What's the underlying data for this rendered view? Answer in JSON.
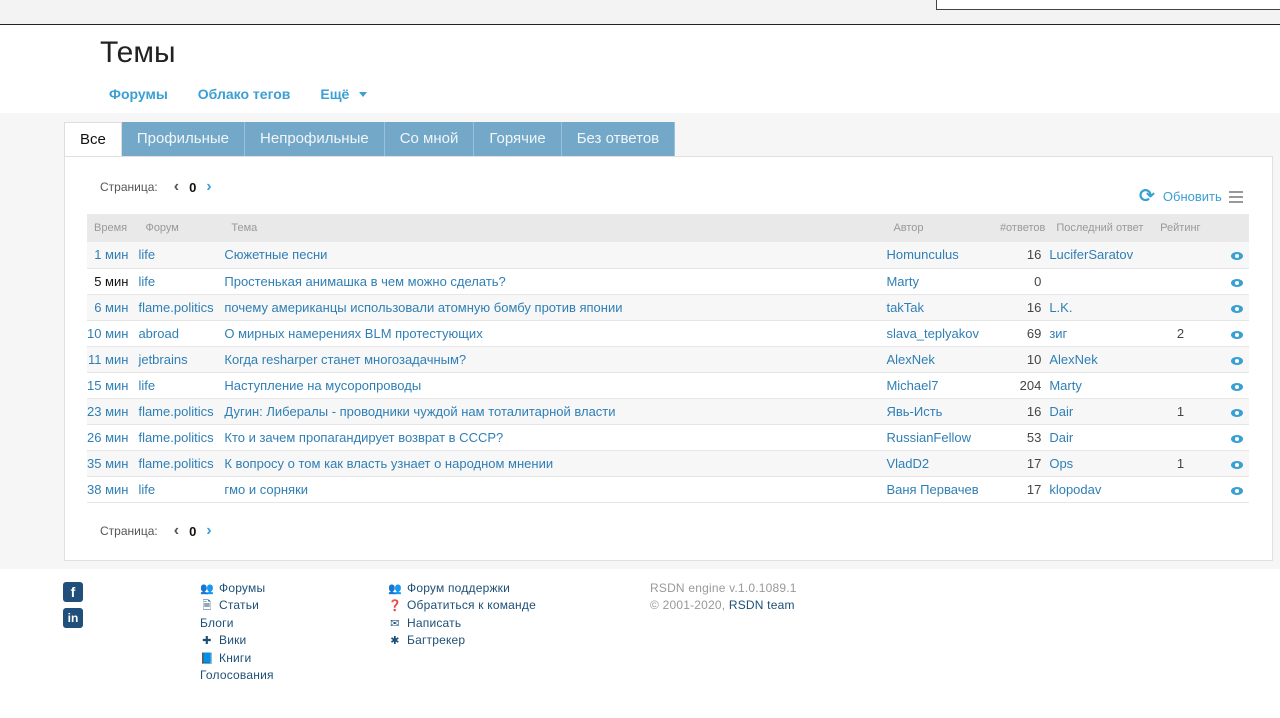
{
  "page": {
    "title": "Темы"
  },
  "subnav": {
    "forums": "Форумы",
    "tag_cloud": "Облако тегов",
    "more": "Ещё"
  },
  "tabs": [
    {
      "label": "Все",
      "active": true
    },
    {
      "label": "Профильные"
    },
    {
      "label": "Непрофильные"
    },
    {
      "label": "Со мной"
    },
    {
      "label": "Горячие"
    },
    {
      "label": "Без ответов"
    }
  ],
  "pager": {
    "label": "Страница:",
    "page": "0",
    "prev": "‹",
    "next": "›"
  },
  "toolbar": {
    "refresh_label": "Обновить",
    "refresh_icon": "⟳"
  },
  "table": {
    "headers": [
      "Время",
      "Форум",
      "Тема",
      "Автор",
      "#ответов",
      "Последний ответ",
      "Рейтинг"
    ],
    "rows": [
      {
        "time": "1 мин",
        "forum": "life",
        "topic": "Сюжетные песни",
        "author": "Homunculus",
        "replies": "16",
        "last": "LuciferSaratov",
        "rating": ""
      },
      {
        "time": "5 мин",
        "forum": "life",
        "topic": "Простенькая анимашка в чем можно сделать?",
        "author": "Marty",
        "replies": "0",
        "last": "",
        "rating": ""
      },
      {
        "time": "6 мин",
        "forum": "flame.politics",
        "topic": "почему американцы использовали атомную бомбу против японии",
        "author": "takTak",
        "replies": "16",
        "last": "L.K.",
        "rating": ""
      },
      {
        "time": "10 мин",
        "forum": "abroad",
        "topic": "О мирных намерениях BLM протестующих",
        "author": "slava_teplyakov",
        "replies": "69",
        "last": "зиг",
        "rating": "2"
      },
      {
        "time": "11 мин",
        "forum": "jetbrains",
        "topic": "Когда resharper станет многозадачным?",
        "author": "AlexNek",
        "replies": "10",
        "last": "AlexNek",
        "rating": ""
      },
      {
        "time": "15 мин",
        "forum": "life",
        "topic": "Наступление на мусоропроводы",
        "author": "Michael7",
        "replies": "204",
        "last": "Marty",
        "rating": ""
      },
      {
        "time": "23 мин",
        "forum": "flame.politics",
        "topic": "Дугин: Либералы - проводники чуждой нам тоталитарной власти",
        "author": "Явь-Исть",
        "replies": "16",
        "last": "Dair",
        "rating": "1"
      },
      {
        "time": "26 мин",
        "forum": "flame.politics",
        "topic": "Кто и зачем пропагандирует возврат в СССР?",
        "author": "RussianFellow",
        "replies": "53",
        "last": "Dair",
        "rating": ""
      },
      {
        "time": "35 мин",
        "forum": "flame.politics",
        "topic": "К вопросу о том как власть узнает о народном мнении",
        "author": "VladD2",
        "replies": "17",
        "last": "Ops",
        "rating": "1"
      },
      {
        "time": "38 мин",
        "forum": "life",
        "topic": "гмо и сорняки",
        "author": "Ваня Первачев",
        "replies": "17",
        "last": "klopodav",
        "rating": ""
      }
    ]
  },
  "social": {
    "facebook": "f",
    "linkedin": "in"
  },
  "footer": {
    "col1": [
      {
        "icon": "users-icon",
        "glyph": "👥",
        "label": "Форумы"
      },
      {
        "icon": "file-icon",
        "glyph": "🗎",
        "label": "Статьи"
      },
      {
        "icon": "",
        "glyph": "",
        "label": "Блоги"
      },
      {
        "icon": "puzzle-icon",
        "glyph": "✚",
        "label": "Вики"
      },
      {
        "icon": "book-icon",
        "glyph": "📘",
        "label": "Книги"
      },
      {
        "icon": "",
        "glyph": "",
        "label": "Голосования"
      }
    ],
    "col2": [
      {
        "icon": "users-icon",
        "glyph": "👥",
        "label": "Форум поддержки"
      },
      {
        "icon": "question-icon",
        "glyph": "❓",
        "label": "Обратиться к команде"
      },
      {
        "icon": "envelope-icon",
        "glyph": "✉",
        "label": "Написать"
      },
      {
        "icon": "bug-icon",
        "glyph": "✱",
        "label": "Багтрекер"
      }
    ],
    "engine": "RSDN engine v.1.0.1089.1",
    "copyright": "© 2001-2020,",
    "team": "RSDN team"
  },
  "colors": {
    "accent": "#3a9fd3",
    "tab": "#74a8c8",
    "footer_link": "#1d4f76"
  }
}
